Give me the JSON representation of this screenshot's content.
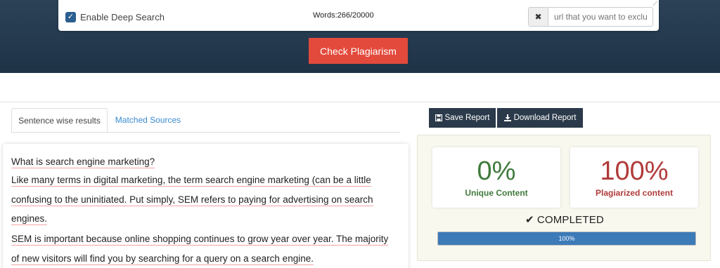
{
  "editor": {
    "deep_search_label": "Enable Deep Search",
    "deep_search_checked": true,
    "word_count": "Words:266/20000",
    "url_clear_symbol": "✖",
    "url_placeholder": "url that you want to exclude",
    "check_button": "Check Plagiarism"
  },
  "tabs": [
    {
      "label": "Sentence wise results",
      "active": true
    },
    {
      "label": "Matched Sources",
      "active": false
    }
  ],
  "sentences": [
    "What is search engine marketing?",
    "Like many terms in digital marketing, the term search engine marketing (can be a little",
    "confusing to the uninitiated. Put simply, SEM refers to paying for advertising on search",
    "engines.",
    "SEM is important because online shopping continues to grow year over year. The majority",
    "of new visitors will find you by searching for a query on a search engine."
  ],
  "report": {
    "save_label": "Save Report",
    "download_label": "Download Report"
  },
  "stats": {
    "unique_value": "0%",
    "unique_label": "Unique Content",
    "plag_value": "100%",
    "plag_label": "Plagiarized content",
    "status": "COMPLETED",
    "progress_text": "100%",
    "progress_fraction": 1.0
  },
  "colors": {
    "header_bg": "#24394d",
    "check_button": "#e34a3c",
    "unique": "#3f7a3c",
    "plagiarized": "#b03a3a",
    "progress": "#3c7ab8"
  }
}
